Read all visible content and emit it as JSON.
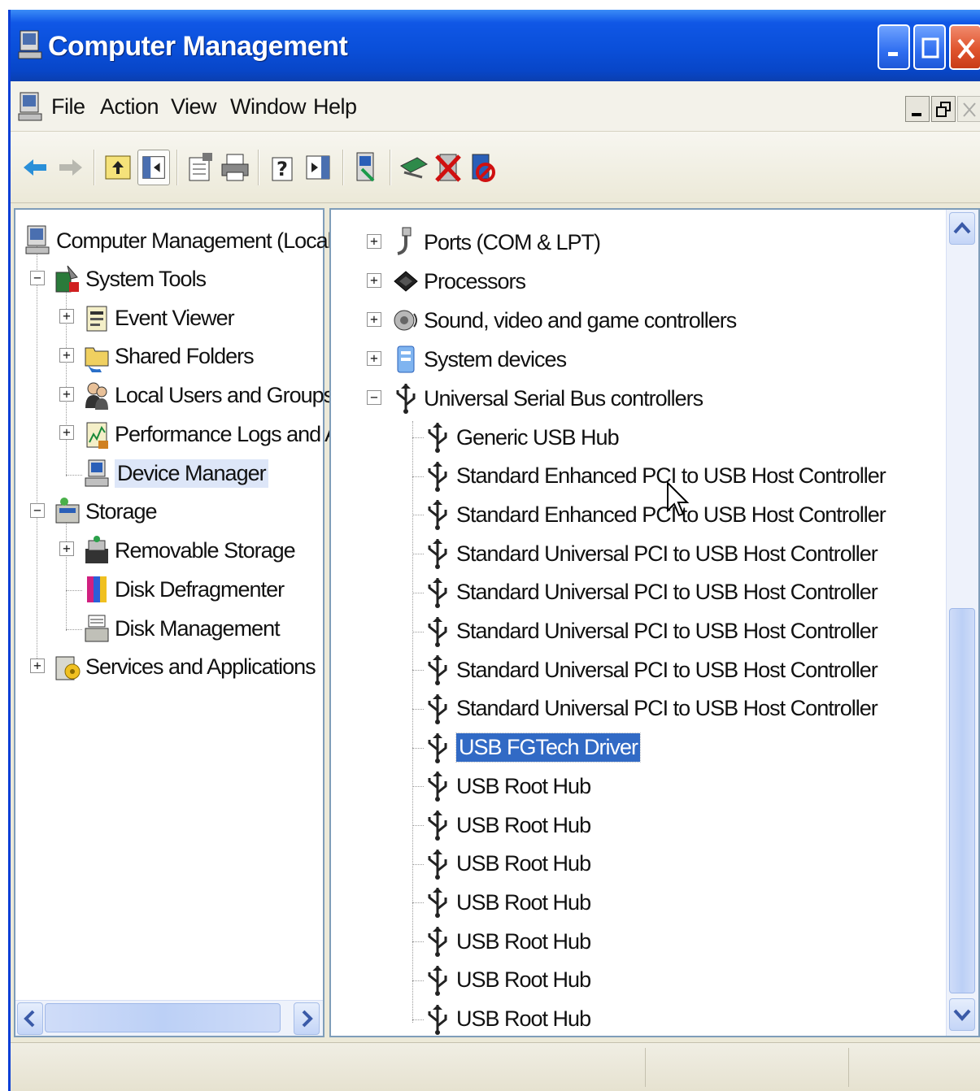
{
  "window": {
    "title": "Computer Management"
  },
  "menu": {
    "items": [
      "File",
      "Action",
      "View",
      "Window",
      "Help"
    ]
  },
  "toolbar": {
    "buttons": [
      "back-icon",
      "forward-icon",
      "up-one-level-icon",
      "show-hide-tree-icon",
      "properties-icon",
      "print-icon",
      "help-icon",
      "show-hide-action-pane-icon",
      "scan-hardware-icon",
      "update-driver-icon",
      "uninstall-icon",
      "disable-icon"
    ]
  },
  "left_tree": {
    "root": "Computer Management (Local)",
    "system_tools": "System Tools",
    "event_viewer": "Event Viewer",
    "shared_folders": "Shared Folders",
    "local_users": "Local Users and Groups",
    "perf_logs": "Performance Logs and Alert:",
    "device_manager": "Device Manager",
    "storage": "Storage",
    "removable_storage": "Removable Storage",
    "disk_defragmenter": "Disk Defragmenter",
    "disk_management": "Disk Management",
    "services": "Services and Applications"
  },
  "device_tree": {
    "categories": [
      "Ports (COM & LPT)",
      "Processors",
      "Sound, video and game controllers",
      "System devices",
      "Universal Serial Bus controllers"
    ],
    "usb_devices": [
      "Generic USB Hub",
      "Standard Enhanced PCI to USB Host Controller",
      "Standard Enhanced PCI to USB Host Controller",
      "Standard Universal PCI to USB Host Controller",
      "Standard Universal PCI to USB Host Controller",
      "Standard Universal PCI to USB Host Controller",
      "Standard Universal PCI to USB Host Controller",
      "Standard Universal PCI to USB Host Controller",
      "USB FGTech Driver",
      "USB Root Hub",
      "USB Root Hub",
      "USB Root Hub",
      "USB Root Hub",
      "USB Root Hub",
      "USB Root Hub",
      "USB Root Hub"
    ],
    "selected": "USB FGTech Driver"
  },
  "colors": {
    "title_bar": "#0a4fd9",
    "selection": "#316ac5",
    "close_button": "#e0552e"
  }
}
